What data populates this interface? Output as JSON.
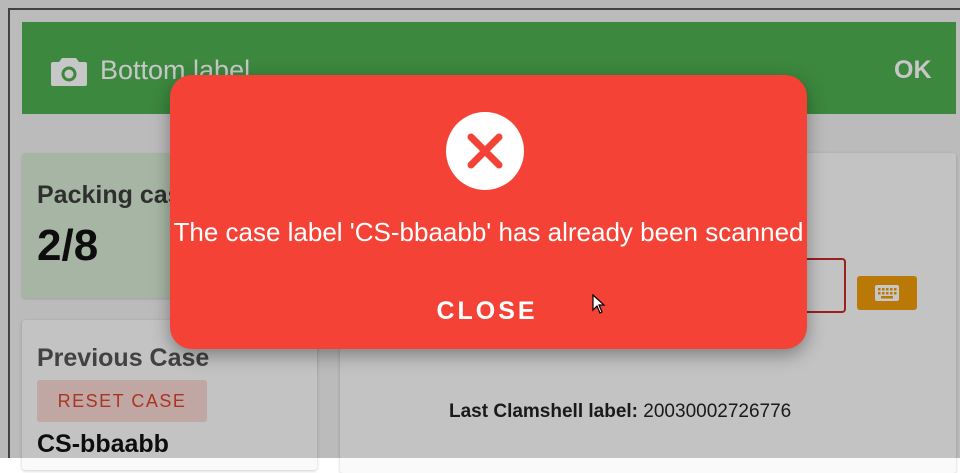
{
  "header": {
    "title": "Bottom label",
    "ok_label": "OK",
    "camera_icon": "camera-icon",
    "color": "#4caf50"
  },
  "packing_card": {
    "label": "Packing case",
    "count": "2/8"
  },
  "previous_card": {
    "label": "Previous Case",
    "reset_label": "RESET CASE",
    "case_id": "CS-bbaabb"
  },
  "panel": {
    "keyboard_icon": "keyboard-icon",
    "last_label_title": "Last Clamshell label:",
    "last_label_value": "20030002726776"
  },
  "dialog": {
    "icon": "error-x-icon",
    "message": "The case label 'CS-bbaabb' has already been scanned",
    "close_label": "CLOSE",
    "color": "#f44336"
  }
}
